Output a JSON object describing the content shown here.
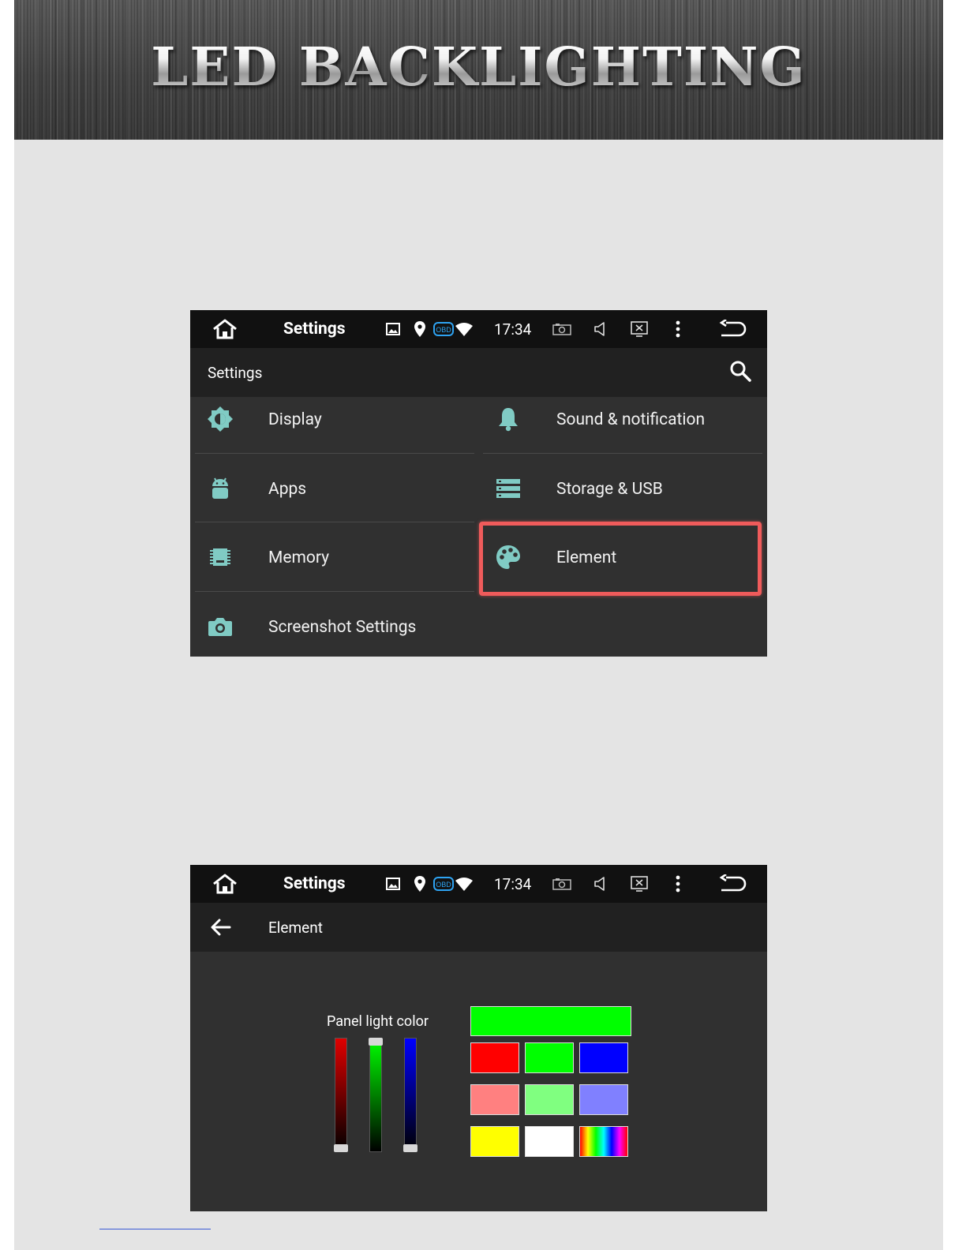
{
  "banner": {
    "title": "LED BACKLIGHTING"
  },
  "screen1": {
    "status": {
      "title": "Settings",
      "time": "17:34",
      "obd": "OBD"
    },
    "appbar": {
      "title": "Settings"
    },
    "items": [
      {
        "label": "Display",
        "icon": "brightness-icon"
      },
      {
        "label": "Sound & notification",
        "icon": "bell-icon"
      },
      {
        "label": "Apps",
        "icon": "android-icon"
      },
      {
        "label": "Storage & USB",
        "icon": "storage-icon"
      },
      {
        "label": "Memory",
        "icon": "memory-chip-icon"
      },
      {
        "label": "Element",
        "icon": "palette-icon",
        "highlighted": true
      },
      {
        "label": "Screenshot Settings",
        "icon": "camera-icon"
      }
    ]
  },
  "screen2": {
    "status": {
      "title": "Settings",
      "time": "17:34",
      "obd": "OBD"
    },
    "appbar": {
      "title": "Element"
    },
    "panel_label": "Panel light color",
    "sliders": {
      "red": 0,
      "green": 1,
      "blue": 0
    },
    "preview_color": "#00ff00",
    "swatches": [
      "#ff0000",
      "#00ff00",
      "#0000ff",
      "#ff8080",
      "#80ff80",
      "#8080ff",
      "#ffff00",
      "#ffffff",
      "rainbow"
    ]
  },
  "colors": {
    "accent_icon": "#80cbc4",
    "highlight_border": "#ef5b5b",
    "screen_bg": "#303030"
  }
}
